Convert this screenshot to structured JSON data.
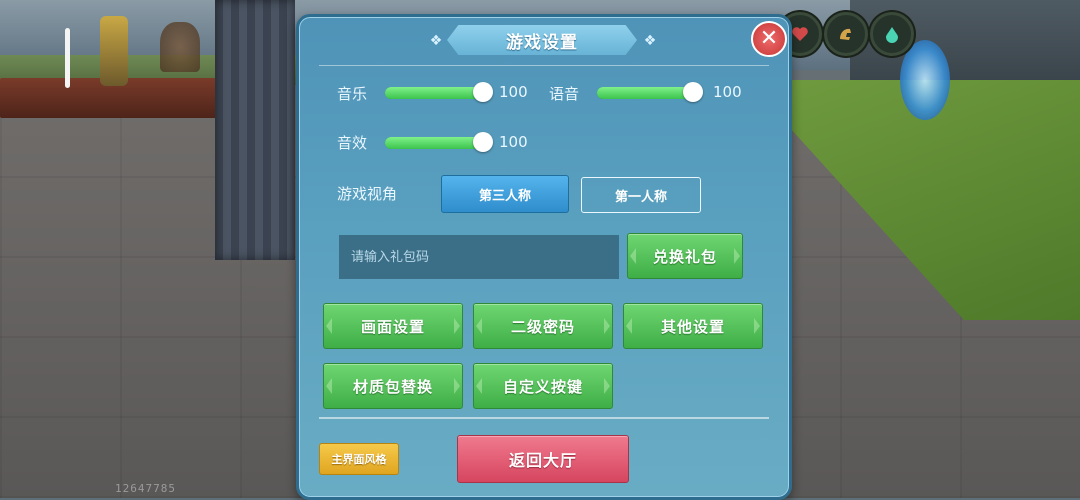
{
  "dialog": {
    "title": "游戏设置",
    "close_icon": "close-icon"
  },
  "audio": {
    "music": {
      "label": "音乐",
      "value": "100",
      "level": 1.0
    },
    "voice": {
      "label": "语音",
      "value": "100",
      "level": 1.0
    },
    "sfx": {
      "label": "音效",
      "value": "100",
      "level": 1.0
    }
  },
  "view": {
    "label": "游戏视角",
    "options": [
      "第三人称",
      "第一人称"
    ],
    "selected": "第三人称"
  },
  "gift": {
    "placeholder": "请输入礼包码",
    "redeem_label": "兑换礼包"
  },
  "buttons": {
    "graphics": "画面设置",
    "secondary_password": "二级密码",
    "other_settings": "其他设置",
    "texture_pack": "材质包替换",
    "custom_keys": "自定义按键"
  },
  "footer": {
    "ui_style": "主界面风格",
    "back_lobby": "返回大厅"
  },
  "hud": {
    "icons": [
      "heart-icon",
      "arm-icon",
      "drop-icon"
    ],
    "player_id": "12647785"
  },
  "colors": {
    "dialog_bg": "#5aa0bf",
    "green_button": "#3fae46",
    "active_tab": "#2e8dcb",
    "yellow_button": "#e0a520",
    "red_button": "#d6455f",
    "slider_fill": "#3cc34d"
  }
}
